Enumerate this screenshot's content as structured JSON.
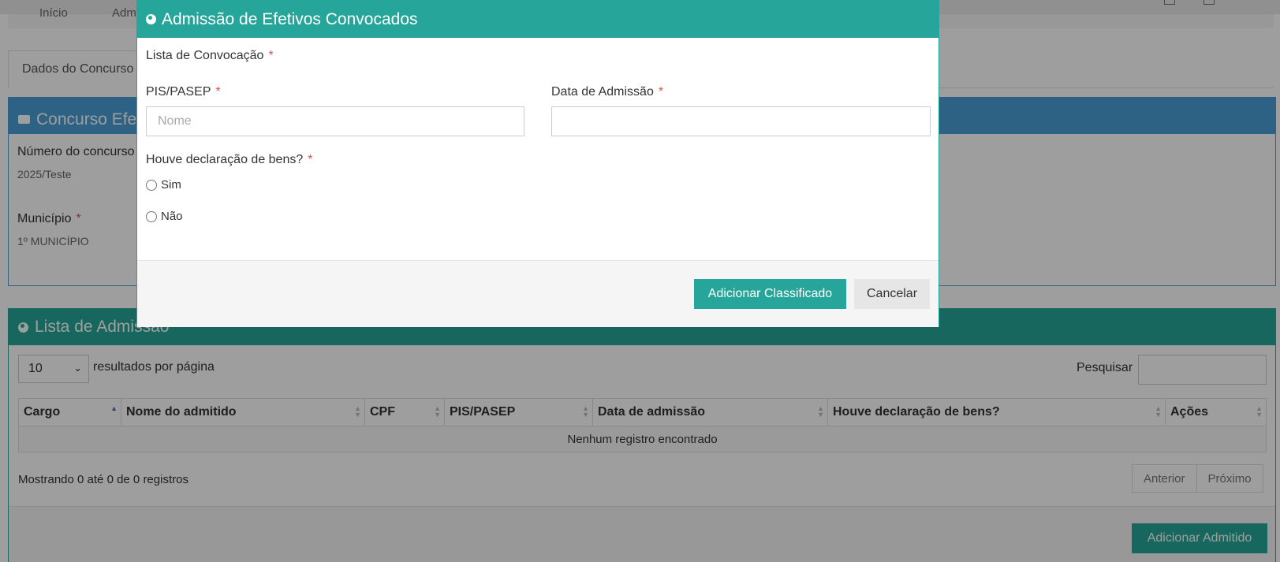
{
  "modal": {
    "title": "Admissão de Efetivos Convocados",
    "lista_label": "Lista de Convocação",
    "pis_label": "PIS/PASEP",
    "pis_placeholder": "Nome",
    "data_label": "Data de Admissão",
    "declaracao_label": "Houve declaração de bens?",
    "option_sim": "Sim",
    "option_nao": "Não",
    "required_mark": "*",
    "btn_add": "Adicionar Classificado",
    "btn_cancel": "Cancelar"
  },
  "breadcrumb": {
    "home": "Início",
    "current": "Admi"
  },
  "tab": {
    "label": "Dados do Concurso"
  },
  "concurso_panel": {
    "title": "Concurso Efet",
    "numero_label": "Número do concurso",
    "numero_value": "2025/Teste",
    "municipio_label": "Município",
    "municipio_value": "1º MUNICÍPIO"
  },
  "admissao_panel": {
    "title": "Lista de Admissão",
    "page_size": "10",
    "per_page_text": "resultados por página",
    "search_label": "Pesquisar",
    "columns": [
      "Cargo",
      "Nome do admitido",
      "CPF",
      "PIS/PASEP",
      "Data de admissão",
      "Houve declaração de bens?",
      "Ações"
    ],
    "empty_text": "Nenhum registro encontrado",
    "showing_text": "Mostrando 0 até 0 de 0 registros",
    "prev": "Anterior",
    "next": "Próximo",
    "add_button": "Adicionar Admitido"
  },
  "colors": {
    "teal": "#26a69a",
    "blue": "#4a9fd6",
    "required": "#d9534f"
  }
}
